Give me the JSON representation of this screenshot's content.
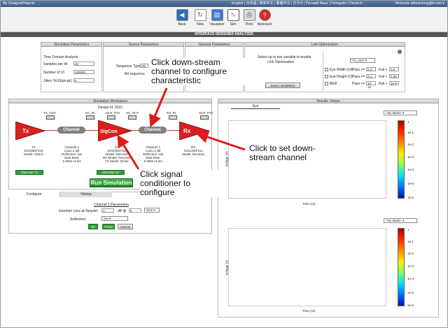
{
  "topbar": {
    "path": "My Designs/Projects",
    "langs": "English | 日本語 | 简体中文 | 繁體中文 | 한국어 | Русский Язык | Português | Deutsch",
    "welcome": "Welcome alfrodchong@ti.com ▾"
  },
  "toolbar": [
    {
      "label": "Back",
      "icon": "back-arrow-icon",
      "color": "#2f6db5",
      "glyph": "◀"
    },
    {
      "label": "New",
      "icon": "refresh-icon",
      "color": "#d22b2b",
      "glyph": "↻"
    },
    {
      "label": "Visualizer",
      "icon": "visualizer-icon",
      "color": "#3a7bd5",
      "glyph": "▤"
    },
    {
      "label": "Sim",
      "icon": "sine-wave-icon",
      "color": "#c0392b",
      "glyph": "∿"
    },
    {
      "label": "Print",
      "icon": "printer-icon",
      "color": "#666666",
      "glyph": "⎙"
    },
    {
      "label": "Assistant",
      "icon": "help-icon",
      "color": "#d22b2b",
      "glyph": "?"
    }
  ],
  "title": "INTERFACE DESIGNER ANALYZER",
  "sim_params": {
    "header": "Simulation Parameters",
    "time_domain": "Time Domain Analysis",
    "samples_label": "Samples per bit",
    "samples_value": "32",
    "num_ui_label": "Number of UI",
    "num_ui_value": "100000",
    "jitter_label": "Jitter( %UI)(pk-pk)",
    "jitter_value": "0"
  },
  "source_params": {
    "header": "Source Parameters",
    "seq_type_label": "Sequence Type:",
    "seq_type_value": "PR",
    "bit_seq_label": "Bit sequence"
  },
  "general_params": {
    "header": "General Parameters"
  },
  "link_opt": {
    "header": "Link Optimization",
    "instructions_1": "Select up to two variable to enable",
    "instructions_2": "Link Optimization",
    "select_btn": "Select Variable(s)",
    "target": "TX_OUT",
    "rows": [
      {
        "label": "Eye Width (UI)",
        "pass_label": "Pass >=",
        "pass_value": "0.2",
        "fail_label": "Fail <",
        "fail_value": "0.2"
      },
      {
        "label": "Eye Height (V)",
        "pass_label": "Pass >=",
        "pass_value": "0.1",
        "fail_label": "Fail <",
        "fail_value": "0.05"
      },
      {
        "label": "BER",
        "pass_label": "Pass <=",
        "pass_value": "1e-12",
        "fail_label": "Fail >",
        "fail_value": "1e-9"
      }
    ]
  },
  "workspace": {
    "header": "Simulation Workspace",
    "design_id": "Design Id: 2022",
    "nodes": [
      "TX_OUT",
      "SC_IN",
      "OUT_PT1",
      "SC_OUT",
      "RX_IN",
      "OUT_PT2"
    ],
    "blocks": {
      "tx": "Tx",
      "ch1": "Channel",
      "sc": "SigCon",
      "ch2": "Channel",
      "rx": "Rx"
    },
    "tx_info": [
      "TX",
      "DS100BT410",
      "Model: CMLO"
    ],
    "ch1_info": [
      "Channel 1",
      "Loss=1 dB",
      "Reflection: low",
      "Data Rate:",
      "5.000e+9 b/s"
    ],
    "sc_info": [
      "SC",
      "DS100DF411",
      "Model: Receiver",
      "RX Model: Receiver",
      "TX Model: Driver"
    ],
    "ch2_info": [
      "Channel 2",
      "Loss=1 dB",
      "Reflection: low",
      "Data Rate:",
      "5.000e+9 b/s"
    ],
    "rx_info": [
      "RX",
      "DS110DF111",
      "Model: Receiver"
    ],
    "alternate_tx": "Alternate TX",
    "alternate_sc": "Alternate SC",
    "run_btn": "Run Simulation"
  },
  "config": {
    "tab_configure": "Configure",
    "tab_history": "History",
    "title": "Channel 1 Parameters",
    "loss_label": "Insertion Loss at Nyquist:",
    "loss_value": "1",
    "loss_unit": "dB @",
    "freq_value": "5",
    "freq_unit": "GHz",
    "refl_label": "Reflection:",
    "refl_value": "low",
    "ok": "OK",
    "pass": "PASS",
    "cancel": "Cancel"
  },
  "results": {
    "header": "Results Viewer",
    "tab_eye": "Eye",
    "mask": "<No Mask>",
    "ylabel": "Voltage (V)",
    "xlabel": "Time (UI)",
    "ticks": [
      "1",
      "1e-1",
      "1e-2",
      "1e-3",
      "1e-4",
      "1e-5",
      "1e-6"
    ]
  },
  "callouts": {
    "downstream_config": "Click  down-stream channel to configure characteristic",
    "set_downstream": "Click to set down-stream channel",
    "signal_conditioner": "Click  signal conditioner to configure"
  },
  "colors": {
    "arrow": "#e01a1a",
    "block_red": "#d92020",
    "channel_gray": "#808080",
    "green": "#2e9e3a"
  }
}
